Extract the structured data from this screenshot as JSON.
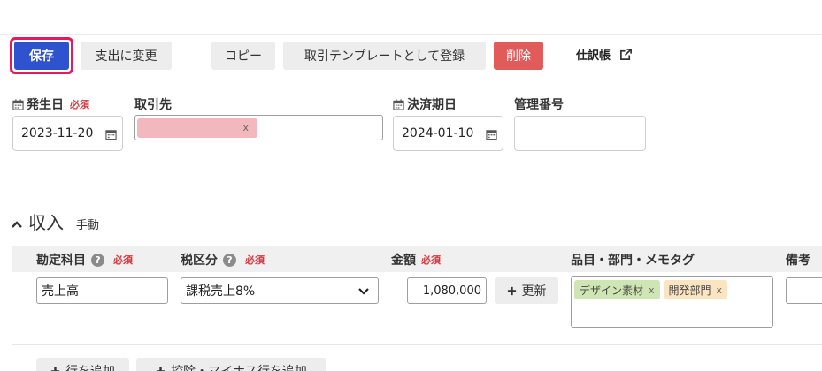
{
  "toolbar": {
    "save_label": "保存",
    "change_to_expense_label": "支出に変更",
    "copy_label": "コピー",
    "register_template_label": "取引テンプレートとして登録",
    "delete_label": "削除",
    "journal_link_label": "仕訳帳"
  },
  "form": {
    "issue_date_label": "発生日",
    "required_label": "必須",
    "issue_date_value": "2023-11-20",
    "partner_label": "取引先",
    "partner_tag_x": "x",
    "settlement_date_label": "決済期日",
    "settlement_date_value": "2024-01-10",
    "management_no_label": "管理番号",
    "management_no_value": ""
  },
  "section": {
    "title": "収入",
    "mode": "手動"
  },
  "table": {
    "headers": {
      "account": "勘定科目",
      "tax": "税区分",
      "amount": "金額",
      "items": "品目・部門・メモタグ",
      "remarks": "備考"
    },
    "help_glyph": "?",
    "rows": [
      {
        "account": "売上高",
        "tax": "課税売上8%",
        "amount": "1,080,000",
        "update_label": "更新",
        "tags": [
          {
            "label": "デザイン素材",
            "x": "x",
            "color": "#cfe6b4"
          },
          {
            "label": "開発部門",
            "x": "x",
            "color": "#fbe4c0"
          }
        ]
      }
    ]
  },
  "footer": {
    "add_row_label": "行を追加",
    "add_deduction_label": "控除・マイナス行を追加"
  },
  "colors": {
    "save": "#2f52cf",
    "save_outline": "#e8185c",
    "delete": "#e25b5b",
    "required": "#d6343b"
  }
}
